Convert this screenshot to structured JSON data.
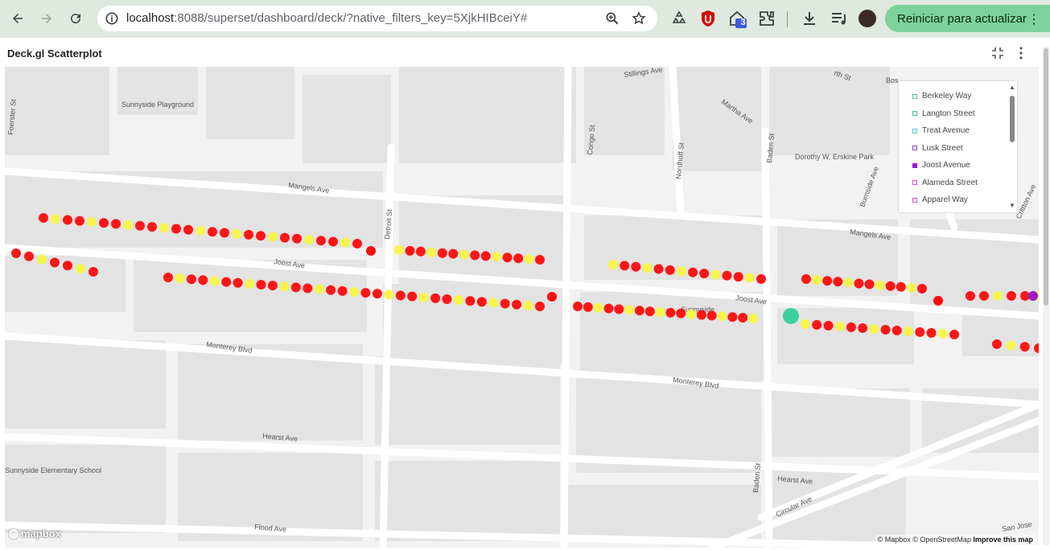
{
  "browser": {
    "url_host": "localhost",
    "url_rest": ":8088/superset/dashboard/deck/?native_filters_key=5XjkHIBceiY#",
    "extension_badge": "3",
    "update_label": "Reiniciar para actualizar",
    "icons": [
      "back-icon",
      "forward-icon",
      "reload-icon",
      "site-info-icon",
      "zoom-icon",
      "star-icon",
      "extension-puzzle-icon",
      "download-icon",
      "media-icon",
      "profile-avatar",
      "menu-icon"
    ]
  },
  "chart": {
    "title": "Deck.gl Scatterplot",
    "legend": [
      {
        "label": "Berkeley Way",
        "color": "#3fcf8e",
        "filled": false
      },
      {
        "label": "Langton Street",
        "color": "#35c0a0",
        "filled": false
      },
      {
        "label": "Treat Avenue",
        "color": "#45c8d8",
        "filled": false
      },
      {
        "label": "Lusk Street",
        "color": "#8a3fd8",
        "filled": false
      },
      {
        "label": "Joost Avenue",
        "color": "#9a1ad0",
        "filled": true
      },
      {
        "label": "Alameda Street",
        "color": "#d94dd0",
        "filled": false
      },
      {
        "label": "Apparel Way",
        "color": "#e04da8",
        "filled": false
      }
    ],
    "point_colors": {
      "red": "#ff0b0b",
      "yellow": "#f8f542",
      "teal": "#3fcf9e",
      "purple": "#9a1ad0"
    }
  },
  "map": {
    "streets": [
      "Stillings Ave",
      "Martha Ave",
      "Sunnyside Playground",
      "Foerster St",
      "Congo St",
      "Nordhoff St",
      "Baden St",
      "Dorothy W. Erskine Park",
      "Burnside Ave",
      "Mangels Ave",
      "Detroit St",
      "Mangels Ave",
      "Joost Ave",
      "Joost Ave",
      "Sunnyside",
      "Monterey Blvd",
      "Monterey Blvd",
      "Hearst Ave",
      "Hearst Ave",
      "Baden St",
      "Circular Ave",
      "Flood Ave",
      "Sunnyside Elementary School",
      "San Jose",
      "Crittton Ave",
      "Bos",
      "rth St"
    ],
    "mapbox_logo": "mapbox",
    "attribution_text": "© Mapbox © OpenStreetMap",
    "attribution_link": "Improve this map"
  }
}
